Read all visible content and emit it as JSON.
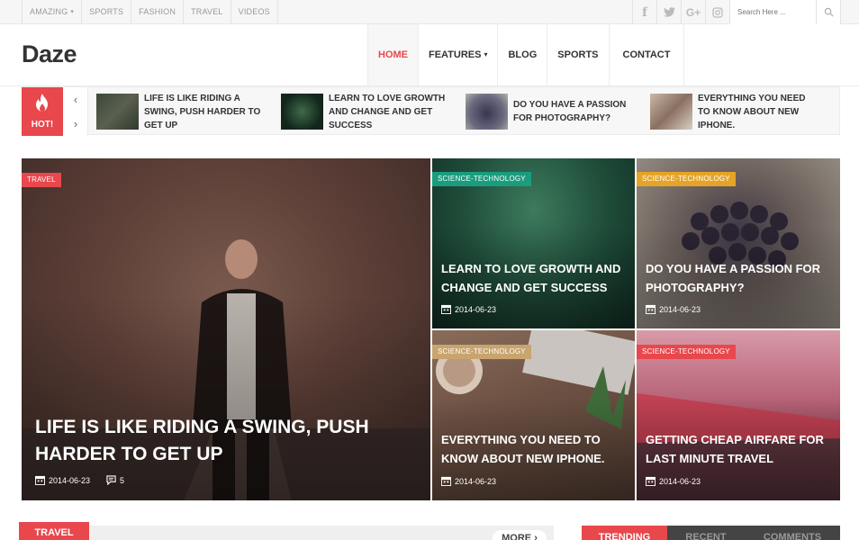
{
  "topbar": {
    "nav": [
      "AMAZING",
      "SPORTS",
      "FASHION",
      "TRAVEL",
      "VIDEOS"
    ],
    "social": [
      "f",
      "t",
      "G+",
      "ig"
    ],
    "search_placeholder": "Search Here ..."
  },
  "header": {
    "logo": "Daze",
    "nav": [
      "HOME",
      "FEATURES",
      "BLOG",
      "SPORTS",
      "CONTACT"
    ]
  },
  "ticker": {
    "hot_label": "HOT!",
    "items": [
      "LIFE IS LIKE RIDING A SWING, PUSH HARDER TO GET UP",
      "LEARN TO LOVE GROWTH AND CHANGE AND GET SUCCESS",
      "DO YOU HAVE A PASSION FOR PHOTOGRAPHY?",
      "EVERYTHING YOU NEED TO KNOW ABOUT NEW IPHONE."
    ]
  },
  "featured": {
    "main": {
      "category": "TRAVEL",
      "title": "LIFE IS LIKE RIDING A SWING, PUSH HARDER TO GET UP",
      "date": "2014-06-23",
      "comments": "5"
    },
    "cards": [
      {
        "category": "SCIENCE-TECHNOLOGY",
        "title": "LEARN TO LOVE GROWTH AND CHANGE AND GET SUCCESS",
        "date": "2014-06-23"
      },
      {
        "category": "SCIENCE-TECHNOLOGY",
        "title": "DO YOU HAVE A PASSION FOR PHOTOGRAPHY?",
        "date": "2014-06-23"
      },
      {
        "category": "SCIENCE-TECHNOLOGY",
        "title": "EVERYTHING YOU NEED TO KNOW ABOUT NEW IPHONE.",
        "date": "2014-06-23"
      },
      {
        "category": "SCIENCE-TECHNOLOGY",
        "title": "GETTING CHEAP AIRFARE FOR LAST MINUTE TRAVEL",
        "date": "2014-06-23"
      }
    ]
  },
  "section": {
    "tab": "TRAVEL",
    "more": "MORE"
  },
  "sidebar_tabs": [
    "TRENDING",
    "RECENT",
    "COMMENTS"
  ],
  "colors": {
    "accent": "#e8474c",
    "teal": "#1a9c7e",
    "amber": "#e5a428",
    "tan": "#c8a46e"
  }
}
